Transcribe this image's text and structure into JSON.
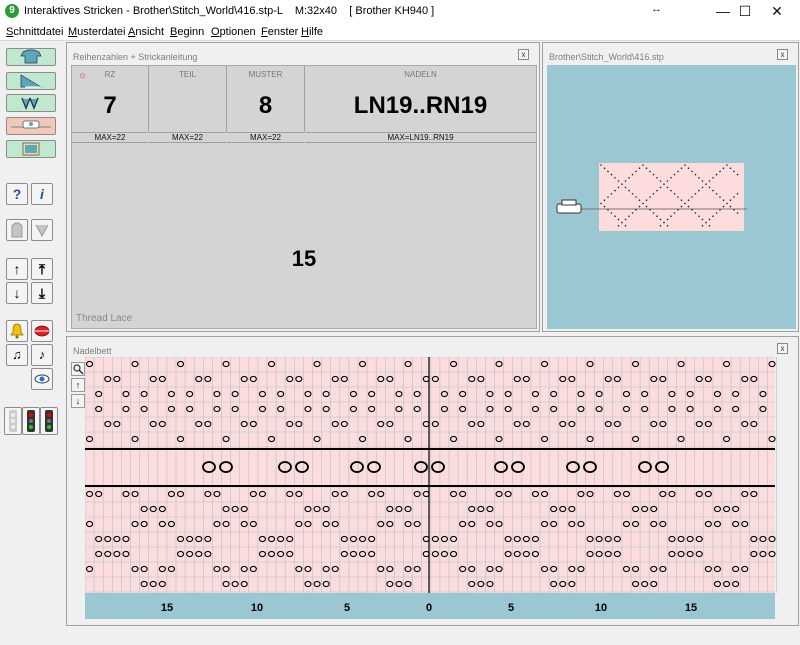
{
  "window": {
    "title": "Interaktives Stricken - Brother\\Stitch_World\\416.stp-L    M:32x40    [ Brother KH940 ]",
    "app_icon_glyph": "9",
    "pin_glyph": "↔",
    "min_glyph": "—",
    "max_glyph": "☐",
    "close_glyph": "✕"
  },
  "menu": [
    "Schnittdatei",
    "Musterdatei",
    "Ansicht",
    "Beginn",
    "Optionen",
    "Fenster",
    "Hilfe"
  ],
  "toolbar": {
    "buttons": [
      "sweater-shape-icon",
      "triangle-pattern-icon",
      "knit-stitch-icon",
      "carriage-icon",
      "image-pattern-icon",
      "help-icon",
      "info-icon",
      "vest-front-icon",
      "vest-knit-icon",
      "arrow-up-icon",
      "arrow-up-top-icon",
      "arrow-down-icon",
      "arrow-down-bottom-icon",
      "bell-icon",
      "lips-icon",
      "music-note-double-icon",
      "music-note-icon",
      "eye-icon",
      "traffic-light-off-icon",
      "traffic-light-red-icon",
      "traffic-light-green-icon"
    ],
    "help_glyph": "?",
    "info_glyph": "i",
    "up_glyph": "↑",
    "up_top_glyph": "⤒",
    "down_glyph": "↓",
    "down_bottom_glyph": "⤓",
    "note2_glyph": "♫",
    "note1_glyph": "♪",
    "bell_glyph": "🔔",
    "eye_glyph": "👁"
  },
  "rows_panel": {
    "title": "Reihenzahlen + Strickanleitung",
    "close": "x",
    "sun_glyph": "☼",
    "columns": [
      {
        "label": "RZ",
        "value": "7",
        "max": "MAX=22"
      },
      {
        "label": "TEIL",
        "value": "",
        "max": "MAX=22"
      },
      {
        "label": "MUSTER",
        "value": "8",
        "max": "MAX=22"
      },
      {
        "label": "NADELN",
        "value": "LN19..RN19",
        "max": "MAX=LN19..RN19"
      }
    ],
    "instruction": "15",
    "pattern_name": "Thread Lace"
  },
  "preview_panel": {
    "title": "Brother\\Stitch_World\\416.stp",
    "close": "x"
  },
  "bed_panel": {
    "title": "Nadelbett",
    "close": "x",
    "axis_labels": [
      "15",
      "10",
      "5",
      "0",
      "5",
      "10",
      "15"
    ],
    "tools": [
      "zoom-icon",
      "arrow-up-icon",
      "arrow-down-icon"
    ],
    "zoom_glyph": "🔍",
    "up_glyph": "↑",
    "down_glyph": "↓",
    "accent_colors": {
      "bed_bg": "#fcdcdc",
      "bed_frame": "#9ac7d1",
      "grid": "#9ab7c4"
    }
  }
}
